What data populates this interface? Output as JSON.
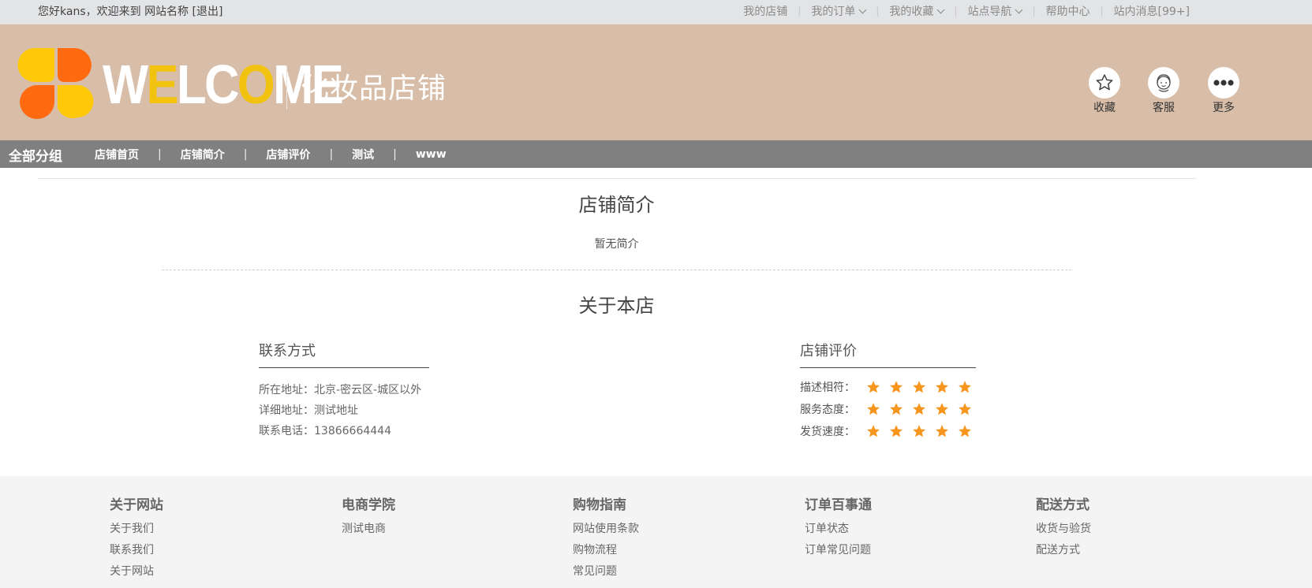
{
  "topbar": {
    "greeting_prefix": "您好kans，欢迎来到",
    "site_name": "网站名称",
    "logout": "[退出]",
    "links": [
      {
        "label": "我的店铺",
        "has_dropdown": false
      },
      {
        "label": "我的订单",
        "has_dropdown": true
      },
      {
        "label": "我的收藏",
        "has_dropdown": true
      },
      {
        "label": "站点导航",
        "has_dropdown": true
      },
      {
        "label": "帮助中心",
        "has_dropdown": false
      },
      {
        "label": "站内消息[99+]",
        "has_dropdown": false
      }
    ]
  },
  "header": {
    "welcome_parts": [
      "W",
      "E",
      "LC",
      "O",
      "ME"
    ],
    "shop_name": "化妆品店铺",
    "icons": [
      {
        "icon": "star-outline-icon",
        "label": "收藏"
      },
      {
        "icon": "customer-service-icon",
        "label": "客服"
      },
      {
        "icon": "more-dots-icon",
        "label": "更多"
      }
    ]
  },
  "nav": {
    "all_groups": "全部分组",
    "items": [
      "店铺首页",
      "店铺简介",
      "店铺评价",
      "测试",
      "www"
    ]
  },
  "intro": {
    "title": "店铺简介",
    "text": "暂无简介"
  },
  "about": {
    "title": "关于本店",
    "contact": {
      "title": "联系方式",
      "rows": [
        "所在地址：北京-密云区-城区以外",
        "详细地址：测试地址",
        "联系电话：13866664444"
      ]
    },
    "rating": {
      "title": "店铺评价",
      "rows": [
        {
          "label": "描述相符：",
          "stars": 5
        },
        {
          "label": "服务态度：",
          "stars": 5
        },
        {
          "label": "发货速度：",
          "stars": 5
        }
      ],
      "star_color": "#f7961e"
    }
  },
  "footer": {
    "columns": [
      {
        "title": "关于网站",
        "links": [
          "关于我们",
          "联系我们",
          "关于网站"
        ]
      },
      {
        "title": "电商学院",
        "links": [
          "测试电商"
        ]
      },
      {
        "title": "购物指南",
        "links": [
          "网站使用条款",
          "购物流程",
          "常见问题"
        ]
      },
      {
        "title": "订单百事通",
        "links": [
          "订单状态",
          "订单常见问题"
        ]
      },
      {
        "title": "配送方式",
        "links": [
          "收货与验货",
          "配送方式"
        ]
      }
    ]
  },
  "colors": {
    "header_bg": "#d8bea8",
    "nav_bg": "#808080",
    "logo_orange": "#ff6a10",
    "logo_yellow": "#ffc90a",
    "welcome_accent": "#f2c210"
  }
}
